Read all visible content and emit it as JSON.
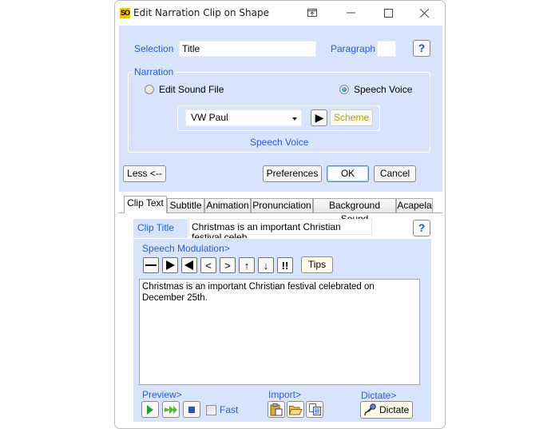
{
  "window": {
    "title": "Edit Narration Clip on Shape",
    "app_icon_text": "SO",
    "controls": [
      "restore-to-top",
      "minimize",
      "maximize",
      "close"
    ]
  },
  "selection": {
    "label": "Selection",
    "value": "Title",
    "paragraph_label": "Paragraph",
    "paragraph_value": "",
    "help_label": "?"
  },
  "narration": {
    "group_label": "Narration",
    "options": [
      {
        "label": "Edit Sound File",
        "selected": false
      },
      {
        "label": "Speech Voice",
        "selected": true
      }
    ],
    "voice": "VW Paul",
    "play_label": "▶",
    "scheme_label": "Scheme",
    "caption": "Speech Voice"
  },
  "buttons": {
    "less": "Less <--",
    "preferences": "Preferences",
    "ok": "OK",
    "cancel": "Cancel"
  },
  "tabs": [
    {
      "label": "Clip Text",
      "active": true
    },
    {
      "label": "Subtitle",
      "active": false
    },
    {
      "label": "Animation",
      "active": false
    },
    {
      "label": "Pronunciation",
      "active": false
    },
    {
      "label": "Background Sound",
      "active": false
    },
    {
      "label": "Acapela",
      "active": false
    }
  ],
  "clip": {
    "title_label": "Clip Title",
    "title_value": "Christmas is an important Christian festival celeb",
    "help_label": "?",
    "modulation_label": "Speech Modulation>",
    "modulation_buttons": [
      {
        "symbol": "—",
        "name": "pause"
      },
      {
        "symbol": "▶",
        "name": "faster"
      },
      {
        "symbol": "◀",
        "name": "slower"
      },
      {
        "symbol": "<",
        "name": "softer"
      },
      {
        "symbol": ">",
        "name": "louder"
      },
      {
        "symbol": "↑",
        "name": "higher-pitch"
      },
      {
        "symbol": "↓",
        "name": "lower-pitch"
      },
      {
        "symbol": "!!",
        "name": "emphasis"
      }
    ],
    "tips_label": "Tips",
    "text": "Christmas is an important Christian festival celebrated on December 25th."
  },
  "preview": {
    "label": "Preview>",
    "fast_label": "Fast",
    "fast_checked": false
  },
  "import": {
    "label": "Import>"
  },
  "dictate": {
    "label": "Dictate>",
    "button_label": "Dictate"
  },
  "colors": {
    "panel_bg": "#d8e4fc",
    "label_blue": "#2a5bd7",
    "scheme_text": "#b8a000"
  }
}
